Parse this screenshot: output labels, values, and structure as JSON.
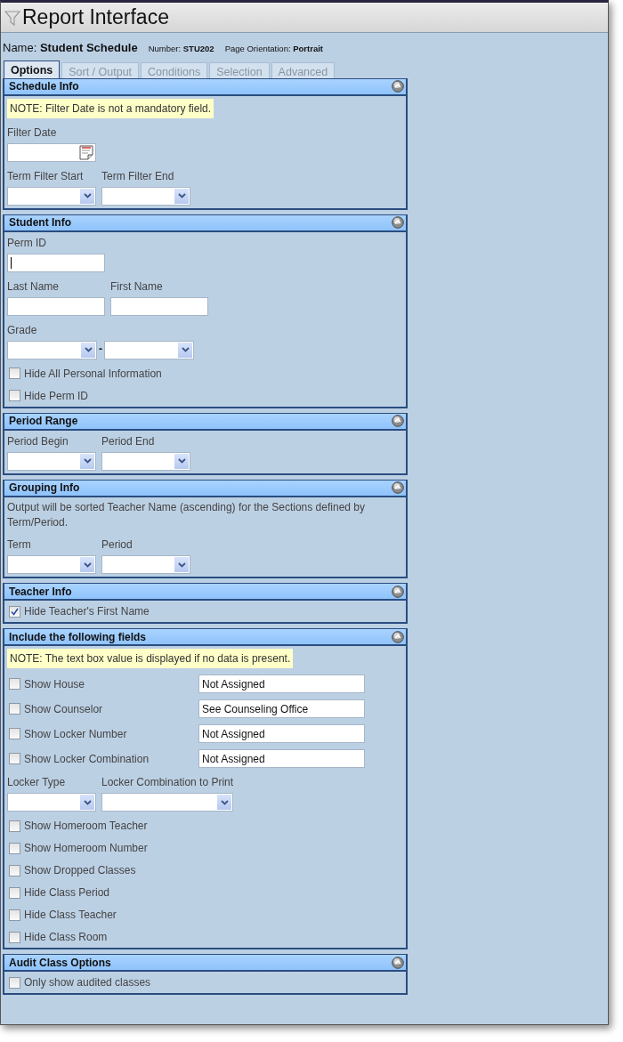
{
  "window": {
    "title": "Report Interface"
  },
  "report": {
    "name": "Name: **Student Schedule**",
    "number": "Number: **STU202**",
    "orientation": "Page Orientation: **Portrait**"
  },
  "tabs": [
    {
      "label": "Options",
      "selected": true
    },
    {
      "label": "Sort / Output",
      "selected": false
    },
    {
      "label": "Conditions",
      "selected": false
    },
    {
      "label": "Selection",
      "selected": false
    },
    {
      "label": "Advanced",
      "selected": false
    }
  ],
  "sections": [
    {
      "title": "Schedule Info",
      "items": [
        {
          "kind": "note",
          "text": "NOTE: Filter Date is not a mandatory field."
        },
        {
          "kind": "fields",
          "fields": [
            {
              "label": "Filter Date",
              "kind": "date"
            }
          ]
        },
        {
          "kind": "fields",
          "fields": [
            {
              "label": "Term Filter Start",
              "kind": "select"
            },
            {
              "label": "Term Filter End",
              "kind": "select"
            }
          ]
        }
      ]
    },
    {
      "title": "Student Info",
      "items": [
        {
          "kind": "fields",
          "fields": [
            {
              "label": "Perm ID",
              "kind": "text",
              "focused": true
            }
          ]
        },
        {
          "kind": "fields",
          "fields": [
            {
              "label": "Last Name",
              "kind": "text",
              "focused": false
            },
            {
              "label": "First Name",
              "kind": "text",
              "focused": false
            }
          ]
        },
        {
          "kind": "range",
          "label": "Grade",
          "separator": "-"
        },
        {
          "kind": "checkbox",
          "label": "Hide All Personal Information",
          "checked": false
        },
        {
          "kind": "checkbox",
          "label": "Hide Perm ID",
          "checked": false
        }
      ]
    },
    {
      "title": "Period Range",
      "items": [
        {
          "kind": "fields",
          "fields": [
            {
              "label": "Period Begin",
              "kind": "select"
            },
            {
              "label": "Period End",
              "kind": "select"
            }
          ]
        }
      ]
    },
    {
      "title": "Grouping Info",
      "items": [
        {
          "kind": "text",
          "text": "Output will be sorted Teacher Name (ascending) for the Sections defined by Term/Period."
        },
        {
          "kind": "fields",
          "fields": [
            {
              "label": "Term",
              "kind": "select"
            },
            {
              "label": "Period",
              "kind": "select"
            }
          ]
        }
      ]
    },
    {
      "title": "Teacher Info",
      "items": [
        {
          "kind": "checkbox",
          "label": "Hide Teacher's First Name",
          "checked": true
        }
      ]
    },
    {
      "title": "Include the following fields",
      "items": [
        {
          "kind": "note",
          "text": "NOTE: The text box value is displayed if no data is present."
        },
        {
          "kind": "checkbox",
          "label": "Show House",
          "checked": false,
          "value": "Not Assigned"
        },
        {
          "kind": "checkbox",
          "label": "Show Counselor",
          "checked": false,
          "value": "See Counseling Office"
        },
        {
          "kind": "checkbox",
          "label": "Show Locker Number",
          "checked": false,
          "value": "Not Assigned"
        },
        {
          "kind": "checkbox",
          "label": "Show Locker Combination",
          "checked": false,
          "value": "Not Assigned"
        },
        {
          "kind": "fields",
          "fields": [
            {
              "label": "Locker Type",
              "kind": "select"
            },
            {
              "label": "Locker Combination to Print",
              "kind": "select"
            }
          ]
        },
        {
          "kind": "checkbox",
          "label": "Show Homeroom Teacher",
          "checked": false
        },
        {
          "kind": "checkbox",
          "label": "Show Homeroom Number",
          "checked": false
        },
        {
          "kind": "checkbox",
          "label": "Show Dropped Classes",
          "checked": false
        },
        {
          "kind": "checkbox",
          "label": "Hide Class Period",
          "checked": false
        },
        {
          "kind": "checkbox",
          "label": "Hide Class Teacher",
          "checked": false
        },
        {
          "kind": "checkbox",
          "label": "Hide Class Room",
          "checked": false
        }
      ]
    },
    {
      "title": "Audit Class Options",
      "items": [
        {
          "kind": "checkbox",
          "label": "Only show audited classes",
          "checked": false
        }
      ]
    }
  ]
}
